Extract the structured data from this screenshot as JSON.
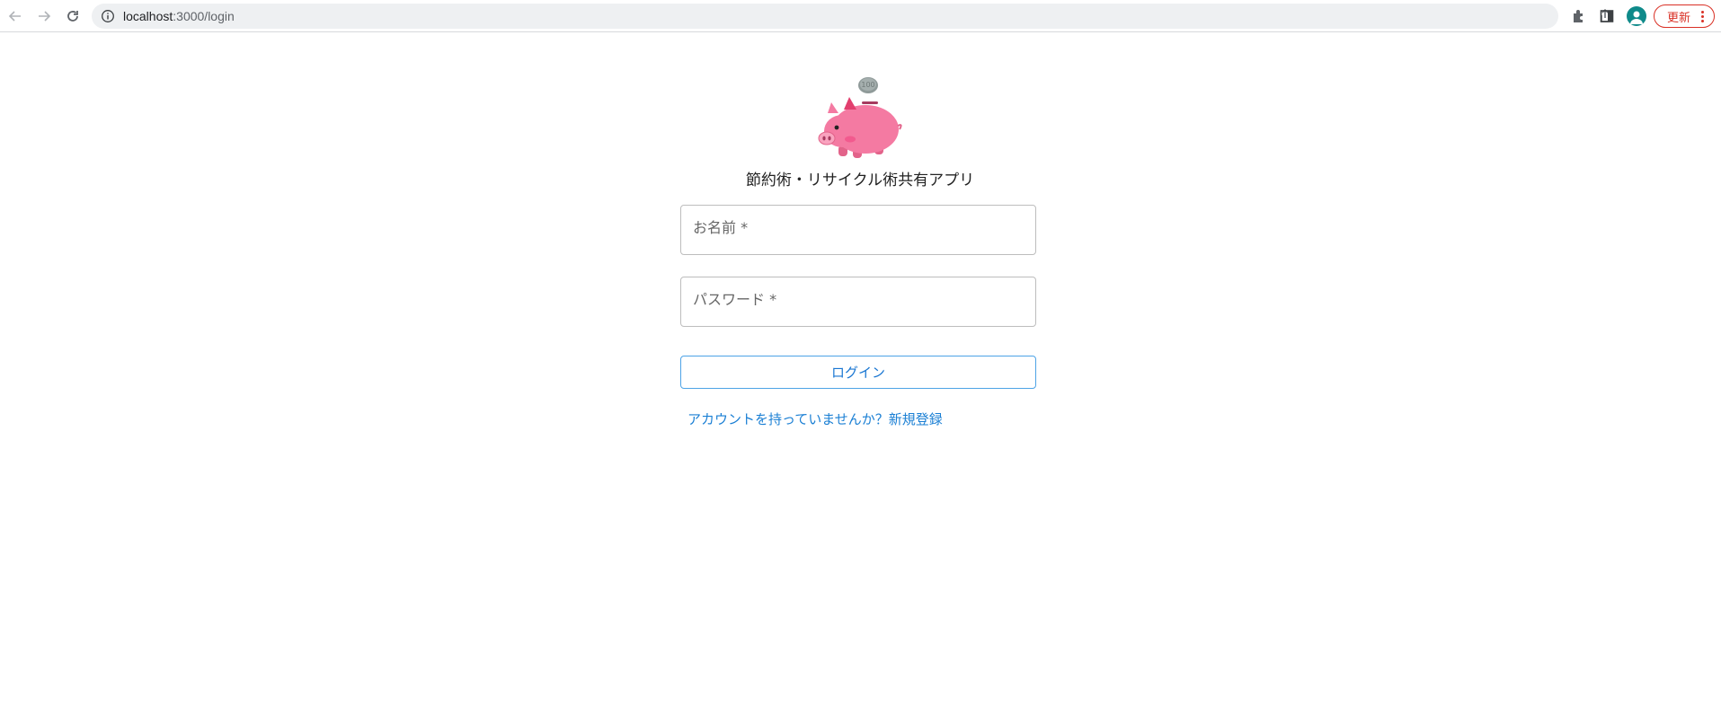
{
  "browser": {
    "url_host": "localhost",
    "url_rest": ":3000/login",
    "update_label": "更新",
    "icons": [
      "back-arrow-icon",
      "forward-arrow-icon",
      "reload-icon",
      "info-icon",
      "share-icon",
      "star-icon",
      "extensions-icon",
      "side-panel-icon",
      "avatar-icon",
      "more-vert-icon"
    ]
  },
  "login": {
    "app_title": "節約術・リサイクル術共有アプリ",
    "name_placeholder": "お名前 *",
    "password_placeholder": "パスワード *",
    "login_button": "ログイン",
    "signup_link": "アカウントを持っていませんか？新規登録",
    "logo_icon": "piggy-bank-icon",
    "coin_text": "100"
  },
  "colors": {
    "accent": "#1976d2",
    "link": "#1a7fd4",
    "update": "#d93025",
    "piggy": "#f47aa2"
  }
}
